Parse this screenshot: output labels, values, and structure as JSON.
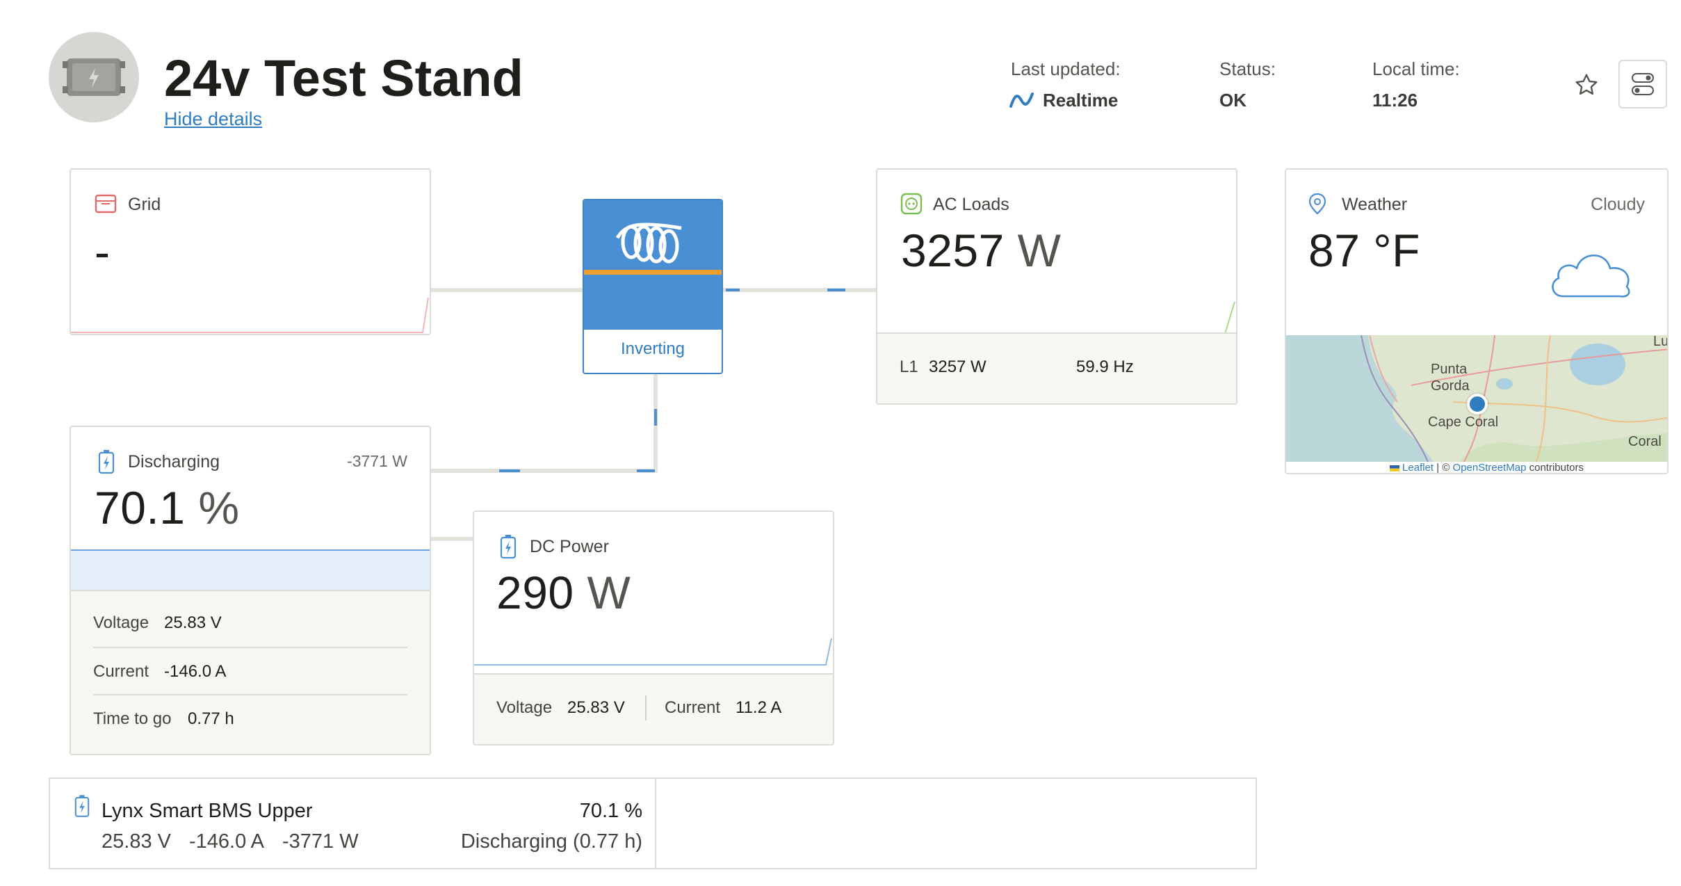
{
  "header": {
    "title": "24v Test Stand",
    "hide_details": "Hide details",
    "last_updated_label": "Last updated:",
    "last_updated_value": "Realtime",
    "status_label": "Status:",
    "status_value": "OK",
    "local_time_label": "Local time:",
    "local_time_value": "11:26"
  },
  "grid": {
    "title": "Grid",
    "value": "-"
  },
  "inverter": {
    "state": "Inverting"
  },
  "ac_loads": {
    "title": "AC Loads",
    "value": "3257",
    "unit": "W",
    "l1_label": "L1",
    "l1_value": "3257 W",
    "frequency": "59.9 Hz"
  },
  "weather": {
    "title": "Weather",
    "condition": "Cloudy",
    "temperature": "87 °F",
    "map_labels": {
      "punta": "Punta",
      "gorda": "Gorda",
      "cape_coral": "Cape Coral",
      "coral": "Coral",
      "lu": "Lu"
    },
    "attribution_leaflet": "Leaflet",
    "attribution_sep": " | © ",
    "attribution_osm": "OpenStreetMap",
    "attribution_tail": " contributors"
  },
  "battery": {
    "title": "Discharging",
    "power": "-3771 W",
    "soc": "70.1",
    "soc_unit": "%",
    "voltage_label": "Voltage",
    "voltage": "25.83 V",
    "current_label": "Current",
    "current": "-146.0 A",
    "ttg_label": "Time to go",
    "ttg": "0.77 h"
  },
  "dc_power": {
    "title": "DC Power",
    "value": "290",
    "unit": "W",
    "voltage_label": "Voltage",
    "voltage": "25.83 V",
    "current_label": "Current",
    "current": "11.2 A"
  },
  "bms": {
    "name": "Lynx Smart BMS Upper",
    "soc": "70.1 %",
    "voltage": "25.83 V",
    "current": "-146.0 A",
    "power": "-3771 W",
    "state": "Discharging (0.77 h)"
  },
  "colors": {
    "accent_blue": "#4a8fd4",
    "grid_red": "#e06a6a",
    "ac_green": "#7bbf52",
    "inverter_orange": "#f0a030"
  }
}
